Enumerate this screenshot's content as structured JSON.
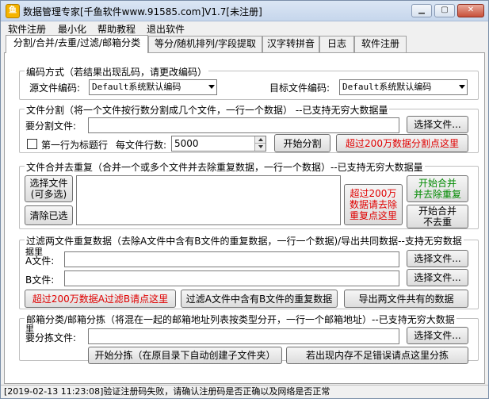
{
  "window": {
    "title": "数据管理专家[千鱼软件www.91585.com]V1.7[未注册]",
    "icon_name": "app-fish-icon",
    "controls": [
      "minimize-icon",
      "maximize-icon",
      "close-icon"
    ]
  },
  "menu": [
    "软件注册",
    "最小化",
    "帮助教程",
    "退出软件"
  ],
  "tabs": [
    "分割/合并/去重/过滤/邮箱分类",
    "等分/随机排列/字段提取",
    "汉字转拼音",
    "日志",
    "软件注册"
  ],
  "encoding": {
    "legend": "编码方式（若结果出现乱码，请更改编码）",
    "source_label": "源文件编码:",
    "source_value": "Default系统默认编码",
    "target_label": "目标文件编码:",
    "target_value": "Default系统默认编码"
  },
  "split": {
    "legend": "文件分割（将一个文件按行数分割成几个文件，一行一个数据） --已支持无穷大数据量",
    "file_label": "要分割文件:",
    "file_value": "",
    "choose_label": "选择文件...",
    "first_row_label": "第一行为标题行",
    "first_row_checked": false,
    "rows_label": "每文件行数:",
    "rows_value": "5000",
    "start_label": "开始分割",
    "big_label": "超过200万数据分割点这里"
  },
  "merge": {
    "legend": "文件合并去重复（合并一个或多个文件并去除重复数据，一行一个数据）--已支持无穷大数据量",
    "choose_line1": "选择文件",
    "choose_line2": "(可多选)",
    "clear_label": "清除已选",
    "big_line1": "超过200万",
    "big_line2": "数据请去除",
    "big_line3": "重复点这里",
    "dedupe_line1": "开始合并",
    "dedupe_line2": "并去除重复",
    "nodedupe_line1": "开始合并",
    "nodedupe_line2": "不去重"
  },
  "filter": {
    "legend": "过滤两文件重复数据（去除A文件中含有B文件的重复数据，一行一个数据)/导出共同数据--支持无穷数据",
    "legend_wrap": "据里",
    "a_label": "A文件:",
    "a_value": "",
    "a_choose": "选择文件...",
    "b_label": "B文件:",
    "b_value": "",
    "b_choose": "选择文件...",
    "big_label": "超过200万数据A过滤B请点这里",
    "filter_label": "过滤A文件中含有B文件的重复数据",
    "export_label": "导出两文件共有的数据"
  },
  "mail": {
    "legend": "邮箱分类/邮箱分拣（将混在一起的邮箱地址列表按类型分开，一行一个邮箱地址）--已支持无穷大数据",
    "legend_wrap": "里",
    "file_label": "要分拣文件:",
    "file_value": "",
    "choose_label": "选择文件...",
    "start_label": "开始分拣（在原目录下自动创建子文件夹）",
    "oom_label": "若出现内存不足错误请点这里分拣"
  },
  "status": "[2019-02-13 11:23:08]验证注册码失败，请确认注册码是否正确以及网络是否正常"
}
